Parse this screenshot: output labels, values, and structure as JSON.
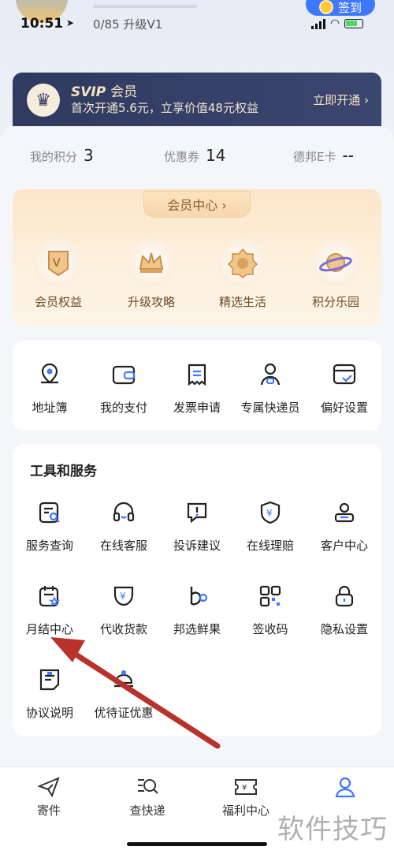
{
  "status": {
    "time": "10:51"
  },
  "header": {
    "level_text": "0/85 升级V1",
    "sign_label": "签到"
  },
  "vip": {
    "title_brand": "SVIP",
    "title_suffix": "会员",
    "desc": "首次开通5.6元，立享价值48元权益",
    "open_label": "立即开通 ›"
  },
  "stats": [
    {
      "label": "我的积分",
      "value": "3"
    },
    {
      "label": "优惠券",
      "value": "14"
    },
    {
      "label": "德邦E卡",
      "value": "--"
    }
  ],
  "member": {
    "center_label": "会员中心 ›",
    "items": [
      {
        "label": "会员权益",
        "icon": "vip-rights-icon"
      },
      {
        "label": "升级攻略",
        "icon": "crown-icon"
      },
      {
        "label": "精选生活",
        "icon": "badge-icon"
      },
      {
        "label": "积分乐园",
        "icon": "planet-icon"
      }
    ]
  },
  "quick": [
    {
      "label": "地址簿",
      "icon": "location-icon"
    },
    {
      "label": "我的支付",
      "icon": "wallet-icon"
    },
    {
      "label": "发票申请",
      "icon": "invoice-icon"
    },
    {
      "label": "专属快递员",
      "icon": "courier-icon"
    },
    {
      "label": "偏好设置",
      "icon": "preference-icon"
    }
  ],
  "tools": {
    "title": "工具和服务",
    "items": [
      {
        "label": "服务查询",
        "icon": "service-search-icon"
      },
      {
        "label": "在线客服",
        "icon": "headset-icon"
      },
      {
        "label": "投诉建议",
        "icon": "complaint-icon"
      },
      {
        "label": "在线理赔",
        "icon": "claim-shield-icon"
      },
      {
        "label": "客户中心",
        "icon": "customer-icon"
      },
      {
        "label": "月结中心",
        "icon": "monthly-calendar-icon"
      },
      {
        "label": "代收货款",
        "icon": "cod-icon"
      },
      {
        "label": "邦选鲜果",
        "icon": "fruit-icon"
      },
      {
        "label": "签收码",
        "icon": "qr-code-icon"
      },
      {
        "label": "隐私设置",
        "icon": "lock-icon"
      },
      {
        "label": "协议说明",
        "icon": "agreement-icon"
      },
      {
        "label": "优待证优惠",
        "icon": "privilege-icon"
      }
    ]
  },
  "nav": [
    {
      "label": "寄件",
      "icon": "send-icon"
    },
    {
      "label": "查快递",
      "icon": "track-icon"
    },
    {
      "label": "福利中心",
      "icon": "coupon-icon"
    },
    {
      "label": "",
      "icon": "profile-icon"
    }
  ],
  "watermark": "软件技巧",
  "colors": {
    "accent": "#3e78ff",
    "vip_bg": "#2f3a60",
    "annotation": "#c0392b"
  }
}
